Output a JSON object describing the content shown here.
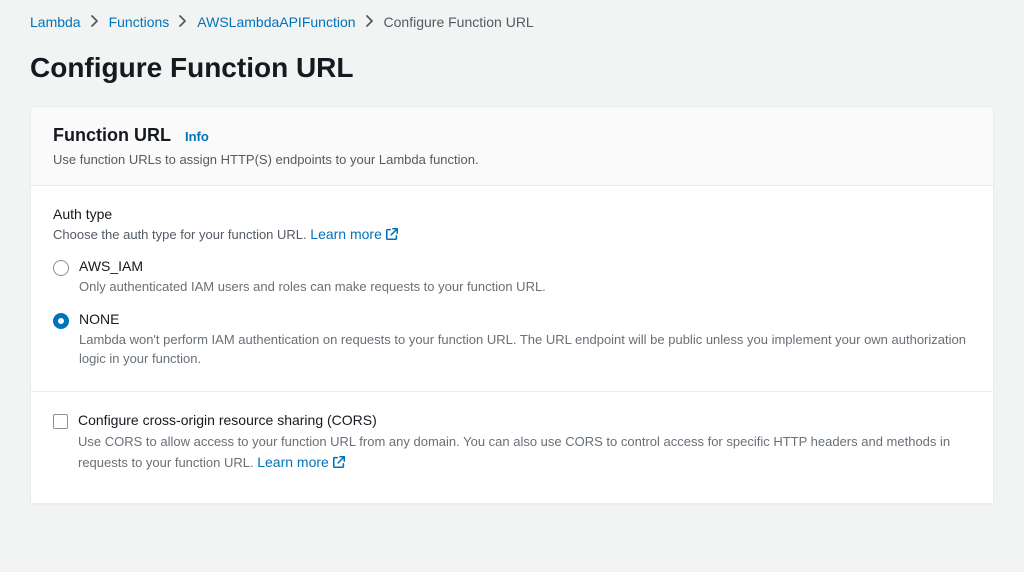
{
  "breadcrumb": {
    "items": [
      "Lambda",
      "Functions",
      "AWSLambdaAPIFunction"
    ],
    "current": "Configure Function URL"
  },
  "page_title": "Configure Function URL",
  "panel": {
    "title": "Function URL",
    "info_label": "Info",
    "description": "Use function URLs to assign HTTP(S) endpoints to your Lambda function."
  },
  "auth_type": {
    "label": "Auth type",
    "description": "Choose the auth type for your function URL.",
    "learn_more": "Learn more",
    "options": [
      {
        "value": "AWS_IAM",
        "label": "AWS_IAM",
        "description": "Only authenticated IAM users and roles can make requests to your function URL.",
        "selected": false
      },
      {
        "value": "NONE",
        "label": "NONE",
        "description": "Lambda won't perform IAM authentication on requests to your function URL. The URL endpoint will be public unless you implement your own authorization logic in your function.",
        "selected": true
      }
    ]
  },
  "cors": {
    "label": "Configure cross-origin resource sharing (CORS)",
    "description": "Use CORS to allow access to your function URL from any domain. You can also use CORS to control access for specific HTTP headers and methods in requests to your function URL.",
    "learn_more": "Learn more",
    "checked": false
  }
}
